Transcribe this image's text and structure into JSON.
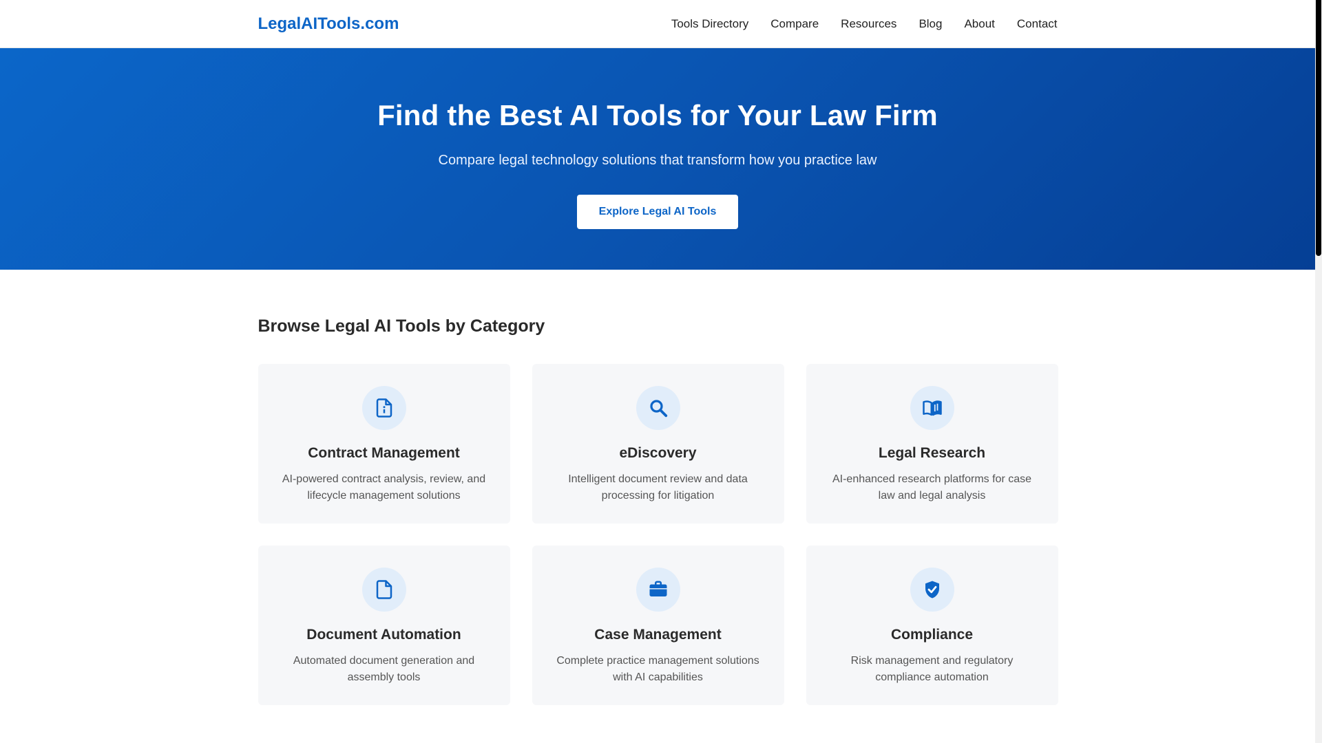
{
  "site": {
    "logo": "LegalAITools.com",
    "nav": [
      {
        "label": "Tools Directory"
      },
      {
        "label": "Compare"
      },
      {
        "label": "Resources"
      },
      {
        "label": "Blog"
      },
      {
        "label": "About"
      },
      {
        "label": "Contact"
      }
    ]
  },
  "hero": {
    "title": "Find the Best AI Tools for Your Law Firm",
    "subtitle": "Compare legal technology solutions that transform how you practice law",
    "cta_label": "Explore Legal AI Tools"
  },
  "categories": {
    "heading": "Browse Legal AI Tools by Category",
    "items": [
      {
        "title": "Contract Management",
        "description": "AI-powered contract analysis, review, and lifecycle management solutions",
        "icon": "contract-document-icon"
      },
      {
        "title": "eDiscovery",
        "description": "Intelligent document review and data processing for litigation",
        "icon": "search-icon"
      },
      {
        "title": "Legal Research",
        "description": "AI-enhanced research platforms for case law and legal analysis",
        "icon": "open-book-icon"
      },
      {
        "title": "Document Automation",
        "description": "Automated document generation and assembly tools",
        "icon": "document-icon"
      },
      {
        "title": "Case Management",
        "description": "Complete practice management solutions with AI capabilities",
        "icon": "briefcase-icon"
      },
      {
        "title": "Compliance",
        "description": "Risk management and regulatory compliance automation",
        "icon": "shield-check-icon"
      }
    ]
  },
  "colors": {
    "brand": "#0d65c7",
    "hero_gradient_start": "#0b66c9",
    "hero_gradient_end": "#053f95",
    "card_bg": "#f6f7f9",
    "icon_circle_bg": "#e1edfa"
  }
}
